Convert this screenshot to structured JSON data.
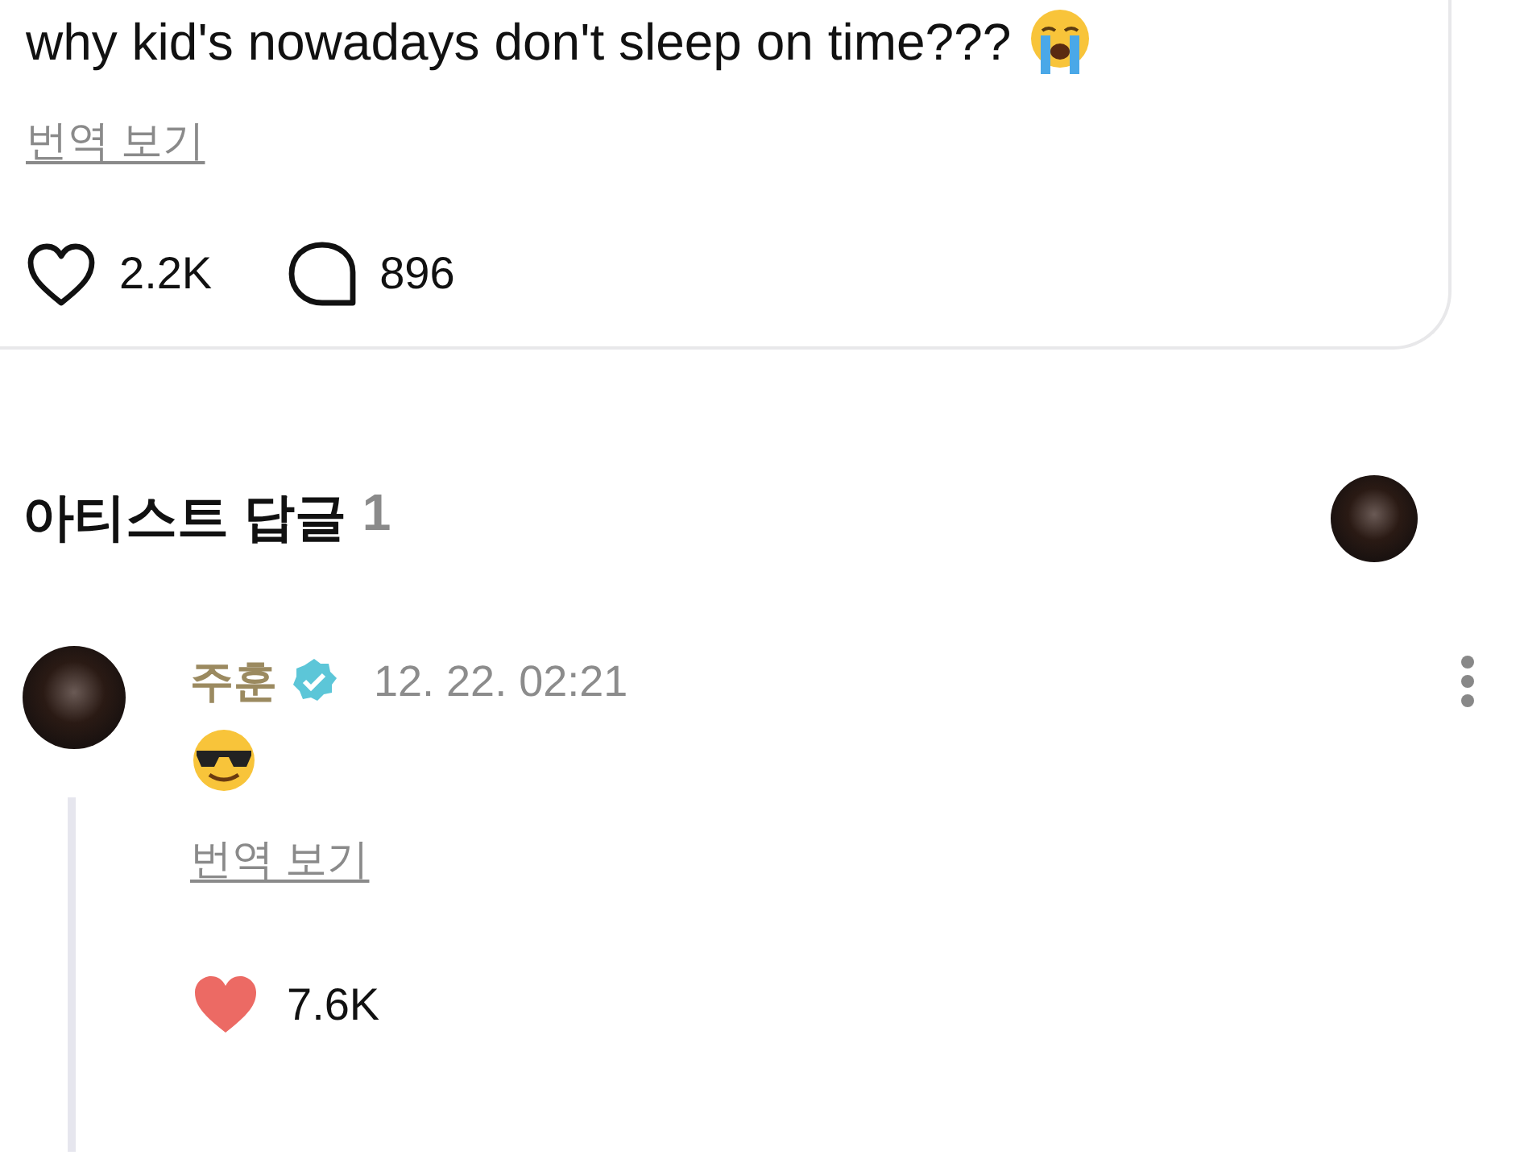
{
  "post": {
    "text": "why kid's nowadays don't sleep on time???",
    "translate_link": "번역 보기",
    "likes": {
      "count": "2.2K",
      "liked": false
    },
    "comments": {
      "count": "896"
    }
  },
  "artist_replies": {
    "title": "아티스트 답글",
    "count": "1",
    "replies": [
      {
        "author": "주훈",
        "verified": true,
        "time": "12. 22. 02:21",
        "translate_link": "번역 보기",
        "likes": {
          "count": "7.6K",
          "liked": true
        }
      }
    ]
  }
}
